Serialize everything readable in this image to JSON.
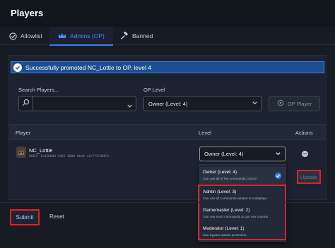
{
  "header": {
    "title": "Players"
  },
  "tabs": [
    {
      "label": "Allowlist",
      "icon": "check-circle-icon"
    },
    {
      "label": "Admins (OP)",
      "icon": "crown-icon",
      "active": true
    },
    {
      "label": "Banned",
      "icon": "hammer-icon"
    }
  ],
  "alert": {
    "text": "Successfully promoted NC_Lottie to OP, level 4"
  },
  "search": {
    "label": "Search Players...",
    "value": ""
  },
  "op_level": {
    "label": "OP Level",
    "selected": "Owner (Level: 4)"
  },
  "op_button": {
    "label": "OP Player"
  },
  "table": {
    "headers": {
      "player": "Player",
      "level": "Level",
      "actions": "Actions"
    },
    "rows": [
      {
        "name": "NC_Lottie",
        "uuid": "UUID: 1e436b0d-9465-4680-bbdd-c4c7f27d805c",
        "level": "Owner (Level: 4)"
      }
    ]
  },
  "dropdown": {
    "options": [
      {
        "title": "Owner (Level: 4)",
        "desc": "Can use all of the commands, includ",
        "selected": true
      },
      {
        "title": "Admin (Level: 3)",
        "desc": "Can use all commands related to multiplaye"
      },
      {
        "title": "Gamemaster (Level: 2)",
        "desc": "Can use most commands & can use comma"
      },
      {
        "title": "Moderator (Level: 1)",
        "desc": "Can bypass spawn protection."
      }
    ]
  },
  "buttons": {
    "update": "Update",
    "submit": "Submit",
    "reset": "Reset"
  },
  "colors": {
    "accent": "#3a7cf0",
    "highlight": "#e0202a",
    "background": "#161b24"
  }
}
